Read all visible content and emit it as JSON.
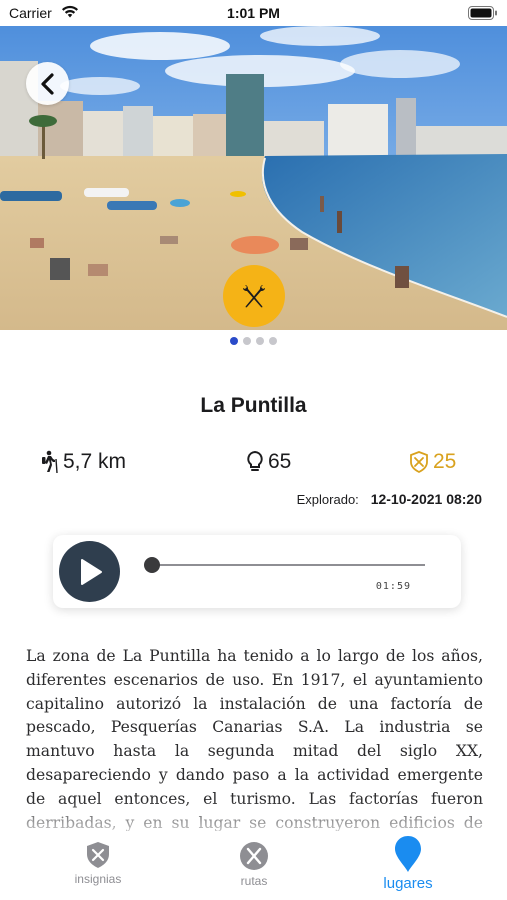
{
  "status_bar": {
    "carrier": "Carrier",
    "time": "1:01 PM"
  },
  "place": {
    "title": "La Puntilla",
    "distance": "5,7 km",
    "likes": "65",
    "points": "25",
    "explored_label": "Explorado:",
    "explored_date": "12-10-2021 08:20"
  },
  "carousel": {
    "page_count": 4,
    "active_index": 0
  },
  "player": {
    "duration": "01:59",
    "progress": 0
  },
  "description": "La zona de La Puntilla ha tenido a lo largo de los años, diferentes escenarios de uso. En 1917, el ayuntamiento capitalino autorizó la instalación de una factoría de pescado, Pesquerías Canarias S.A. La industria se mantuvo hasta la segunda mitad del siglo XX, desapareciendo y dando paso a la actividad emergente de aquel entonces, el turismo. Las factorías fueron derribadas, y en su lugar se construyeron edificios de apartamentos, hoteles y restaurantes.",
  "tabs": [
    {
      "label": "insignias",
      "icon": "shield-icon",
      "active": false
    },
    {
      "label": "rutas",
      "icon": "route-icon",
      "active": false
    },
    {
      "label": "lugares",
      "icon": "map-pin-icon",
      "active": true
    }
  ],
  "colors": {
    "accent_yellow": "#f5b316",
    "points_gold": "#d9a21e",
    "active_tab_blue": "#1a8cf0",
    "player_dark": "#2f3e4e",
    "dot_active": "#2a4bc9"
  }
}
